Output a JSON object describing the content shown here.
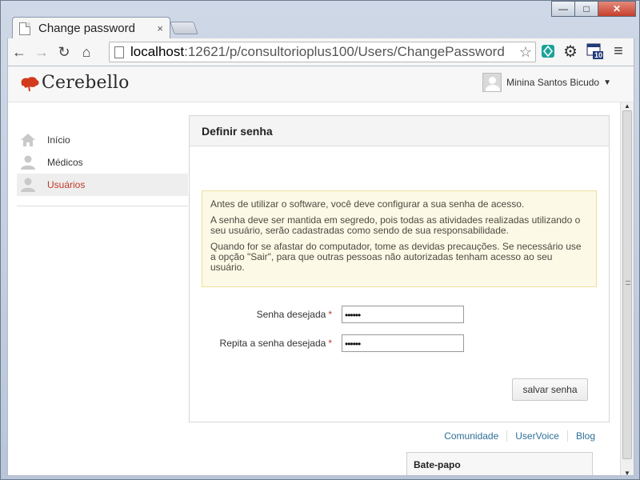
{
  "browser": {
    "tab_title": "Change password",
    "tab_close": "×",
    "url_host": "localhost",
    "url_rest": ":12621/p/consultorioplus100/Users/ChangePassword",
    "window_minimize": "—",
    "window_maximize": "□",
    "window_close": "✕",
    "back_glyph": "←",
    "forward_glyph": "→",
    "reload_glyph": "↻",
    "home_glyph": "⌂",
    "star_glyph": "☆",
    "gear_glyph": "⚙",
    "menu_glyph": "≡",
    "badge_count": "10"
  },
  "header": {
    "brand": "Cerebello",
    "user_name": "Minina Santos Bicudo",
    "user_caret": "▼"
  },
  "sidebar": {
    "items": [
      {
        "label": "Início",
        "icon": "home-icon",
        "active": false
      },
      {
        "label": "Médicos",
        "icon": "user-icon",
        "active": false
      },
      {
        "label": "Usuários",
        "icon": "user-icon",
        "active": true
      }
    ]
  },
  "panel": {
    "title": "Definir senha",
    "notice": [
      "Antes de utilizar o software, você deve configurar a sua senha de acesso.",
      "A senha deve ser mantida em segredo, pois todas as atividades realizadas utilizando o seu usuário, serão cadastradas como sendo de sua responsabilidade.",
      "Quando for se afastar do computador, tome as devidas precauções. Se necessário use a opção \"Sair\", para que outras pessoas não autorizadas tenham acesso ao seu usuário."
    ],
    "field_password_label": "Senha desejada",
    "field_password_value": "••••••",
    "field_confirm_label": "Repita a senha desejada",
    "field_confirm_value": "••••••",
    "required_mark": "*",
    "save_label": "salvar senha"
  },
  "footer": {
    "links": [
      "Comunidade",
      "UserVoice",
      "Blog"
    ]
  },
  "chat": {
    "title": "Bate-papo"
  },
  "colors": {
    "accent_red": "#c0392b",
    "link_blue": "#2e6f98",
    "notice_bg": "#fcf9e6"
  }
}
